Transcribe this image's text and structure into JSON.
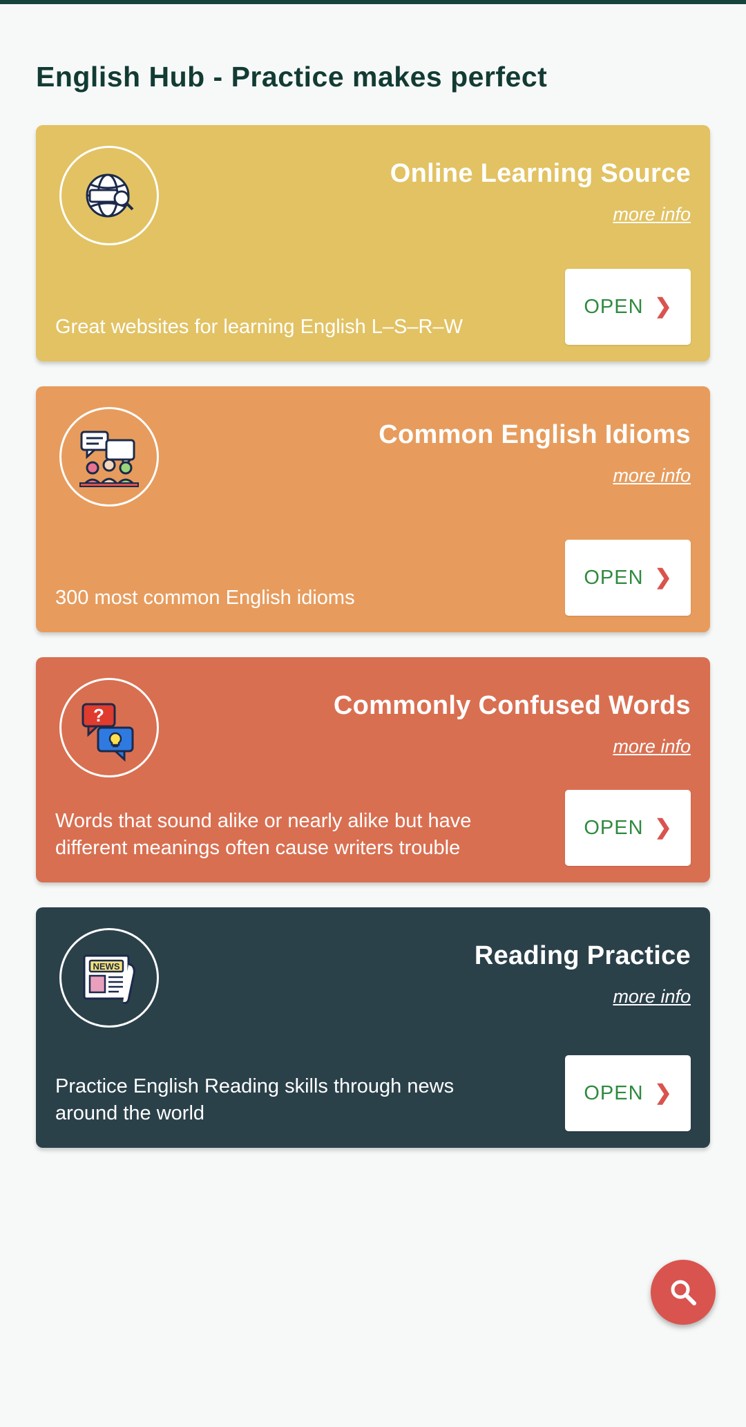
{
  "app": {
    "title": "English Hub - Practice makes perfect",
    "accent_top_bar": "#16443c",
    "background": "#f7f9f8",
    "fab": {
      "icon": "search-icon",
      "color": "#d9544f"
    }
  },
  "cards": [
    {
      "title": "Online Learning Source",
      "more_info": "more info",
      "description": "Great websites for learning English L–S–R–W",
      "open_label": "OPEN",
      "color": "#e2c263",
      "icon": "globe-search-icon"
    },
    {
      "title": "Common English Idioms",
      "more_info": "more info",
      "description": "300 most common English idioms",
      "open_label": "OPEN",
      "color": "#e79c5d",
      "icon": "speech-bubbles-people-icon"
    },
    {
      "title": "Commonly Confused Words",
      "more_info": "more info",
      "description": "Words that sound alike or nearly alike but have different meanings often cause writers trouble",
      "open_label": "OPEN",
      "color": "#d96f51",
      "icon": "question-idea-bubbles-icon"
    },
    {
      "title": "Reading Practice",
      "more_info": "more info",
      "description": "Practice English Reading skills through news around the world",
      "open_label": "OPEN",
      "color": "#2b414a",
      "icon": "newspaper-icon"
    }
  ]
}
